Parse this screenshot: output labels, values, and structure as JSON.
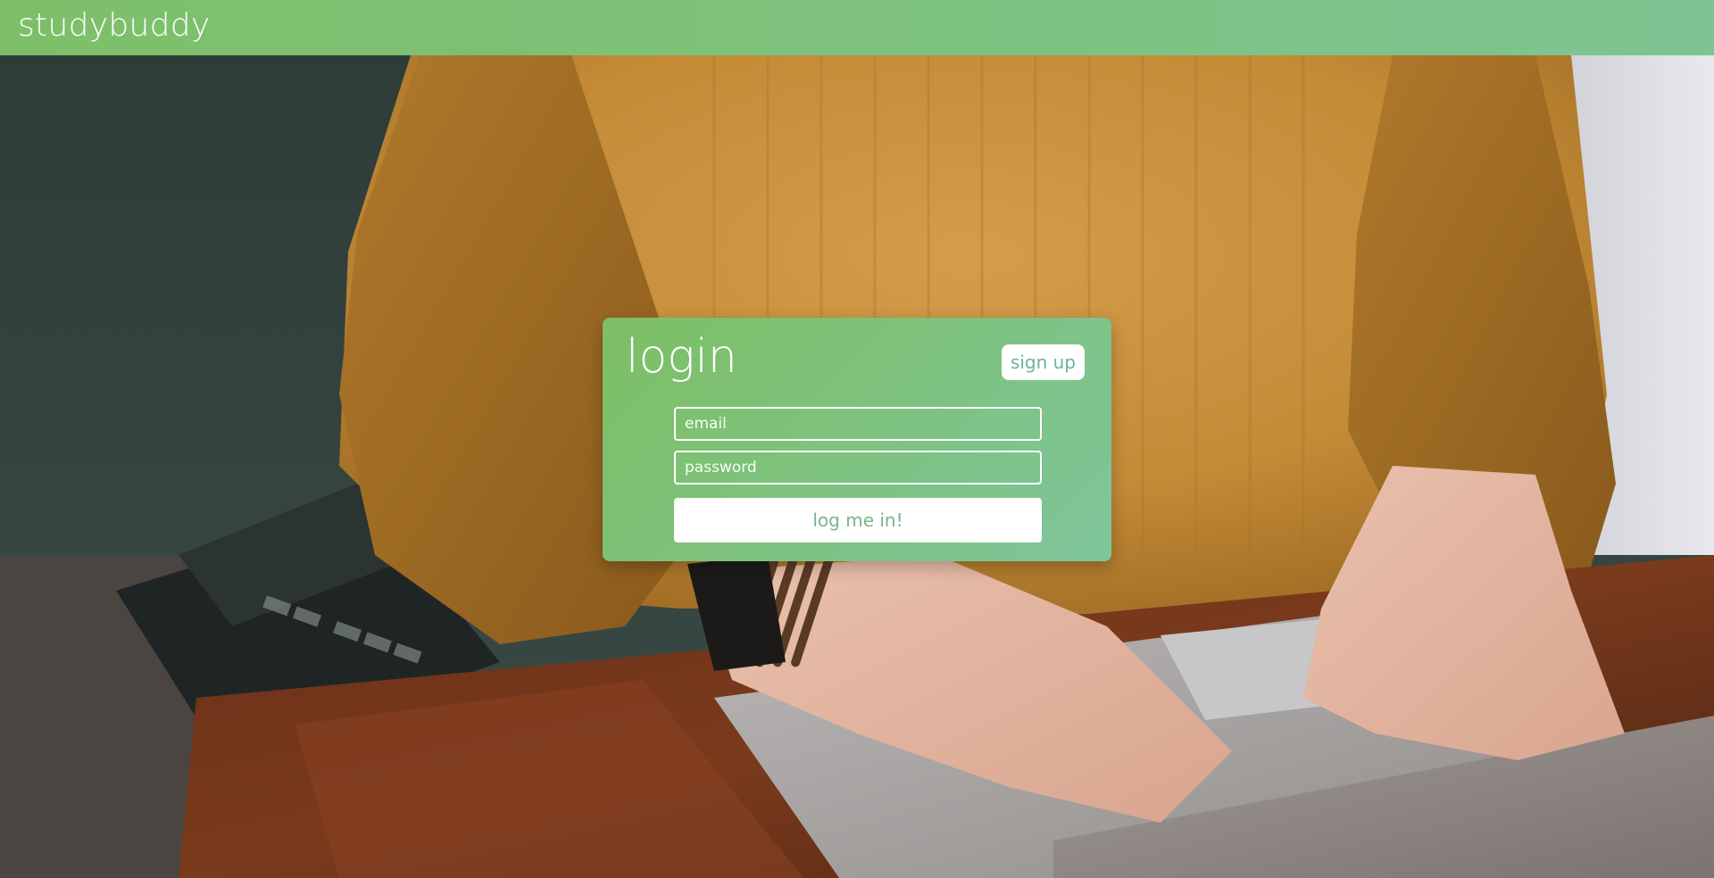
{
  "navbar": {
    "brand": "studybuddy"
  },
  "login": {
    "title": "login",
    "signup_label": "sign up",
    "email_placeholder": "email",
    "password_placeholder": "password",
    "submit_label": "log me in!"
  },
  "theme": {
    "accent_start": "#7dbf68",
    "accent_end": "#7ec493",
    "text_on_accent": "#ffffff"
  }
}
